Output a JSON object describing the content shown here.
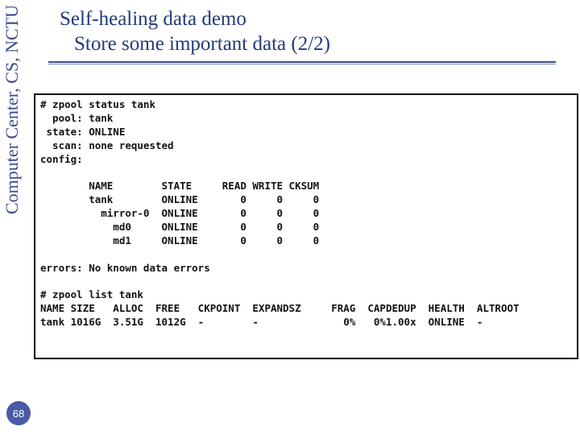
{
  "sidebar": {
    "label": "Computer Center, CS, NCTU"
  },
  "heading": {
    "line1": "Self-healing data demo",
    "line2": "Store some important data (2/2)"
  },
  "terminal": {
    "cmd_status": "# zpool status tank",
    "status_lines": [
      "  pool: tank",
      " state: ONLINE",
      "  scan: none requested",
      "config:"
    ],
    "config_header": [
      "NAME",
      "STATE",
      "READ",
      "WRITE",
      "CKSUM"
    ],
    "config_rows": [
      {
        "name": "tank",
        "state": "ONLINE",
        "read": "0",
        "write": "0",
        "cksum": "0"
      },
      {
        "name": "mirror-0",
        "state": "ONLINE",
        "read": "0",
        "write": "0",
        "cksum": "0",
        "indent": 2
      },
      {
        "name": "md0",
        "state": "ONLINE",
        "read": "0",
        "write": "0",
        "cksum": "0",
        "indent": 4
      },
      {
        "name": "md1",
        "state": "ONLINE",
        "read": "0",
        "write": "0",
        "cksum": "0",
        "indent": 4
      }
    ],
    "errors_line": "errors: No known data errors",
    "cmd_list": "# zpool list tank",
    "list_header": [
      "NAME",
      "SIZE",
      "ALLOC",
      "FREE",
      "CKPOINT",
      "EXPANDSZ",
      "FRAG",
      "CAP",
      "DEDUP",
      "HEALTH",
      "ALTROOT"
    ],
    "list_row": [
      "tank",
      "1016G",
      "3.51G",
      "1012G",
      "-",
      "-",
      "0%",
      "0%",
      "1.00x",
      "ONLINE",
      "-"
    ]
  },
  "page_number": "68"
}
